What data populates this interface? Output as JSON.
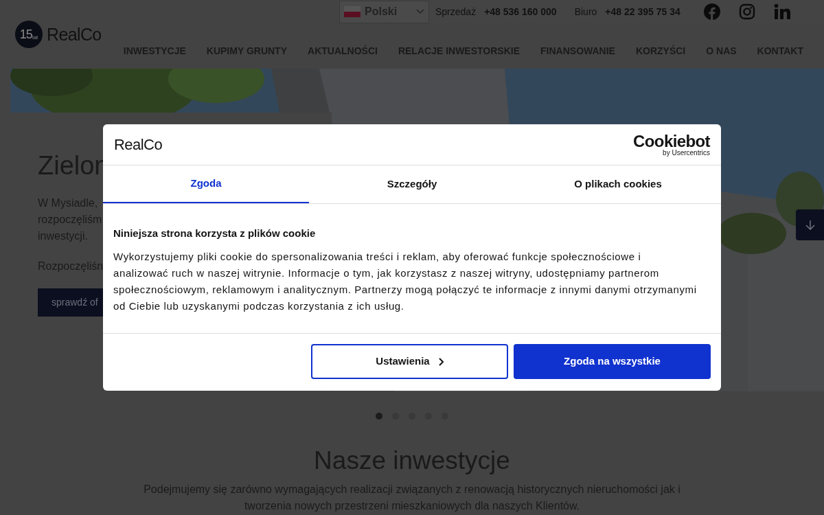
{
  "header": {
    "logo": {
      "badge": "15",
      "badge_sub": "lat",
      "name": "RealCo"
    },
    "language": {
      "label": "Polski"
    },
    "contacts": [
      {
        "label": "Sprzedaż",
        "phone": "+48 536 160 000"
      },
      {
        "label": "Biuro",
        "phone": "+48 22 395 75 34"
      }
    ],
    "nav": [
      "INWESTYCJE",
      "KUPIMY GRUNTY",
      "AKTUALNOŚCI",
      "RELACJE INWESTORSKIE",
      "FINANSOWANIE",
      "KORZYŚCI",
      "O NAS",
      "KONTAKT"
    ]
  },
  "hero": {
    "title": "Zielon",
    "lines": [
      "W Mysiadle, ",
      "rozpoczęliśm",
      "inwestycji."
    ],
    "text_2": "Rozpoczęliśn",
    "button": "sprawdź of"
  },
  "carousel_dots": [
    {
      "selected": true
    },
    {
      "selected": false
    },
    {
      "selected": false
    },
    {
      "selected": false
    },
    {
      "selected": false
    }
  ],
  "section": {
    "title": "Nasze inwestycje",
    "text": "Podejmujemy się zarówno wymagających realizacji związanych z renowacją historycznych nieruchomości jak i tworzenia nowych przestrzeni mieszkaniowych dla naszych Klientów."
  },
  "cookie_dialog": {
    "brand": "RealCo",
    "provider": "Cookiebot",
    "provider_sub": "by Usercentrics",
    "tabs": [
      {
        "label": "Zgoda",
        "selected": true
      },
      {
        "label": "Szczegóły",
        "selected": false
      },
      {
        "label": "O plikach cookies",
        "selected": false
      }
    ],
    "heading": "Niniejsza strona korzysta z plików cookie",
    "text": "Wykorzystujemy pliki cookie do spersonalizowania treści i reklam, aby oferować funkcje społecznościowe i analizować ruch w naszej witrynie. Informacje o tym, jak korzystasz z naszej witryny, udostępniamy partnerom społecznościowym, reklamowym i analitycznym. Partnerzy mogą połączyć te informacje z innymi danymi otrzymanymi od Ciebie lub uzyskanymi podczas korzystania z ich usług.",
    "buttons": [
      {
        "label": "Ustawienia",
        "kind": "outline"
      },
      {
        "label": "Zgoda na wszystkie",
        "kind": "primary"
      }
    ]
  }
}
